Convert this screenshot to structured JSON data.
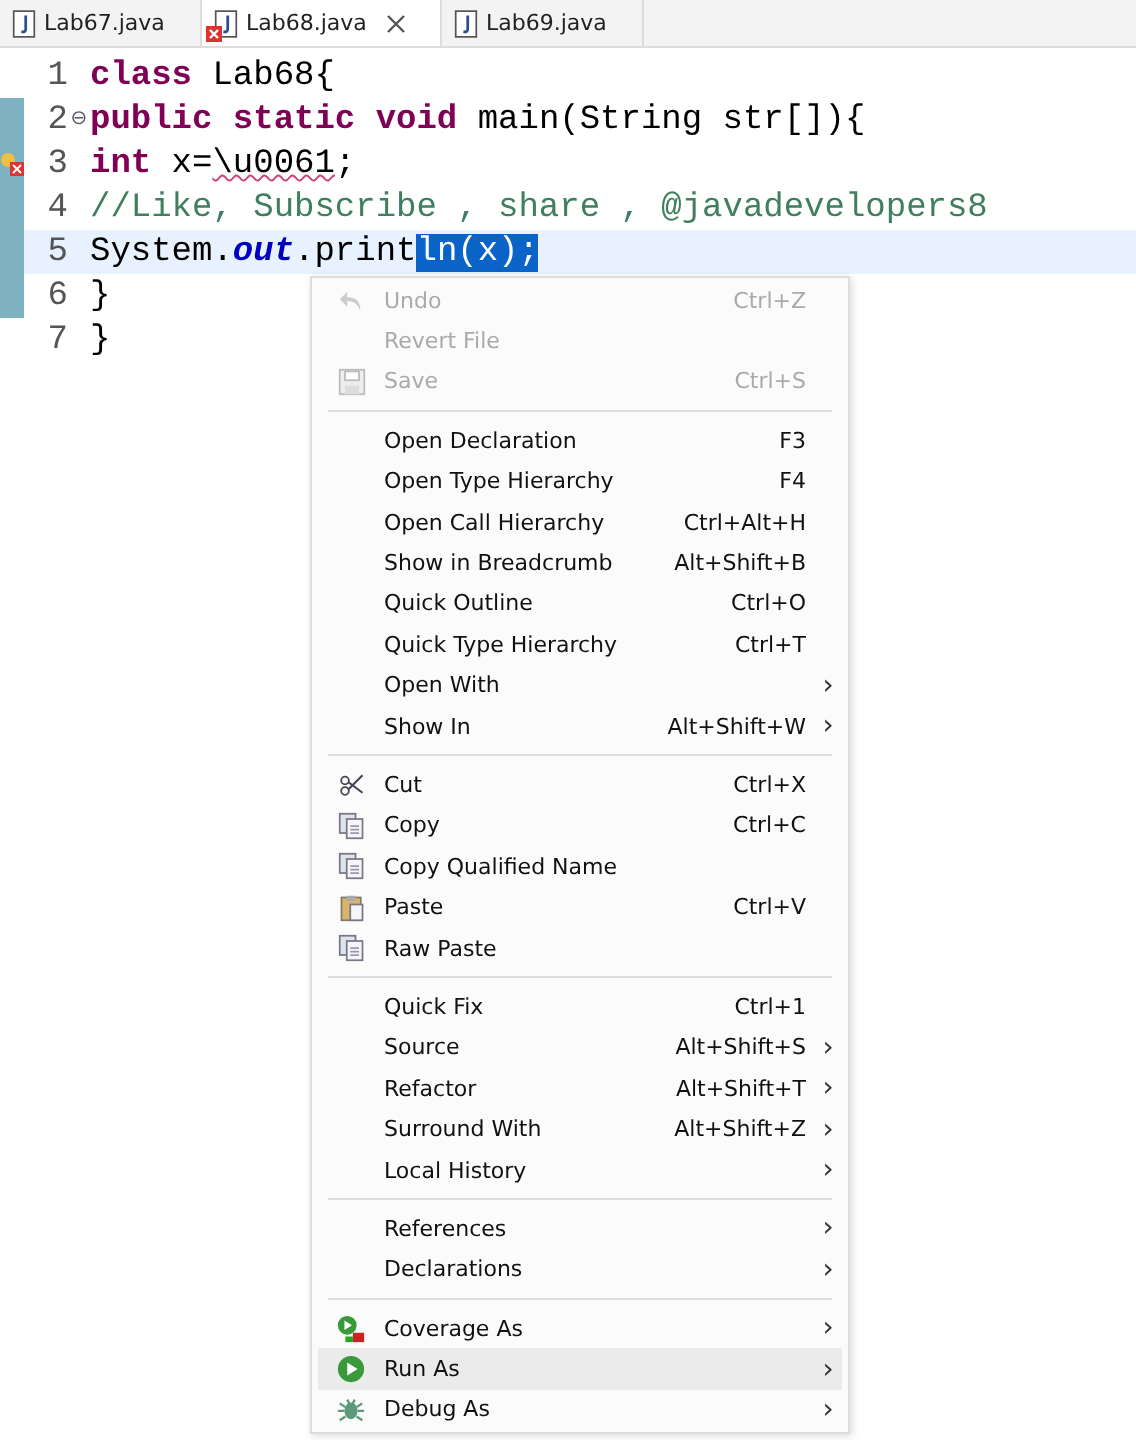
{
  "tabs": [
    {
      "label": "Lab67.java",
      "selected": false,
      "error": false
    },
    {
      "label": "Lab68.java",
      "selected": true,
      "error": true
    },
    {
      "label": "Lab69.java",
      "selected": false,
      "error": false
    }
  ],
  "editor": {
    "lines": [
      {
        "number": "1",
        "changed": false,
        "error": false,
        "current": false,
        "tokens": [
          {
            "kind": "keyword",
            "text": "class"
          },
          {
            "kind": "plain",
            "text": " Lab68{"
          }
        ]
      },
      {
        "number": "2",
        "fold_marker": "⊖",
        "changed": true,
        "error": false,
        "current": false,
        "tokens": [
          {
            "kind": "keyword",
            "text": "public static void"
          },
          {
            "kind": "plain",
            "text": " main(String str[]){"
          }
        ]
      },
      {
        "number": "3",
        "changed": true,
        "error": true,
        "current": false,
        "tokens": [
          {
            "kind": "keyword",
            "text": "int"
          },
          {
            "kind": "plain",
            "text": " x="
          },
          {
            "kind": "squiggly",
            "text": "\\u0061"
          },
          {
            "kind": "plain",
            "text": ";"
          }
        ]
      },
      {
        "number": "4",
        "changed": true,
        "error": false,
        "current": false,
        "tokens": [
          {
            "kind": "comment",
            "text": "//Like, Subscribe , share , @javadevelopers8"
          }
        ]
      },
      {
        "number": "5",
        "changed": true,
        "error": false,
        "current": true,
        "tokens": [
          {
            "kind": "plain",
            "text": "System."
          },
          {
            "kind": "field",
            "text": "out"
          },
          {
            "kind": "plain",
            "text": ".print"
          },
          {
            "kind": "selected",
            "text": "ln(x);"
          }
        ]
      },
      {
        "number": "6",
        "changed": true,
        "error": false,
        "current": false,
        "tokens": [
          {
            "kind": "plain",
            "text": "}"
          }
        ]
      },
      {
        "number": "7",
        "changed": false,
        "error": false,
        "current": false,
        "tokens": [
          {
            "kind": "plain",
            "text": "}"
          }
        ]
      }
    ]
  },
  "context_menu": {
    "groups": [
      [
        {
          "label": "Undo",
          "shortcut": "Ctrl+Z",
          "kind": "undo",
          "disabled": true,
          "selected": false
        },
        {
          "label": "Revert File",
          "kind": "plain",
          "disabled": true,
          "selected": false
        },
        {
          "label": "Save",
          "shortcut": "Ctrl+S",
          "kind": "save",
          "disabled": true,
          "selected": false
        }
      ],
      [
        {
          "label": "Open Declaration",
          "shortcut": "F3",
          "kind": "plain",
          "disabled": false,
          "selected": false
        },
        {
          "label": "Open Type Hierarchy",
          "shortcut": "F4",
          "kind": "plain",
          "disabled": false,
          "selected": false
        },
        {
          "label": "Open Call Hierarchy",
          "shortcut": "Ctrl+Alt+H",
          "kind": "plain",
          "disabled": false,
          "selected": false
        },
        {
          "label": "Show in Breadcrumb",
          "shortcut": "Alt+Shift+B",
          "kind": "plain",
          "disabled": false,
          "selected": false
        },
        {
          "label": "Quick Outline",
          "shortcut": "Ctrl+O",
          "kind": "plain",
          "disabled": false,
          "selected": false
        },
        {
          "label": "Quick Type Hierarchy",
          "shortcut": "Ctrl+T",
          "kind": "plain",
          "disabled": false,
          "selected": false
        },
        {
          "label": "Open With",
          "kind": "plain",
          "disabled": false,
          "selected": false,
          "arrow": "›"
        },
        {
          "label": "Show In",
          "shortcut": "Alt+Shift+W",
          "kind": "plain",
          "disabled": false,
          "selected": false,
          "arrow": "›"
        }
      ],
      [
        {
          "label": "Cut",
          "shortcut": "Ctrl+X",
          "kind": "cut",
          "disabled": false,
          "selected": false
        },
        {
          "label": "Copy",
          "shortcut": "Ctrl+C",
          "kind": "copy",
          "disabled": false,
          "selected": false
        },
        {
          "label": "Copy Qualified Name",
          "kind": "copy",
          "disabled": false,
          "selected": false
        },
        {
          "label": "Paste",
          "shortcut": "Ctrl+V",
          "kind": "paste",
          "disabled": false,
          "selected": false
        },
        {
          "label": "Raw Paste",
          "kind": "copy",
          "disabled": false,
          "selected": false
        }
      ],
      [
        {
          "label": "Quick Fix",
          "shortcut": "Ctrl+1",
          "kind": "plain",
          "disabled": false,
          "selected": false
        },
        {
          "label": "Source",
          "shortcut": "Alt+Shift+S",
          "kind": "plain",
          "disabled": false,
          "selected": false,
          "arrow": "›"
        },
        {
          "label": "Refactor",
          "shortcut": "Alt+Shift+T",
          "kind": "plain",
          "disabled": false,
          "selected": false,
          "arrow": "›"
        },
        {
          "label": "Surround With",
          "shortcut": "Alt+Shift+Z",
          "kind": "plain",
          "disabled": false,
          "selected": false,
          "arrow": "›"
        },
        {
          "label": "Local History",
          "kind": "plain",
          "disabled": false,
          "selected": false,
          "arrow": "›"
        }
      ],
      [
        {
          "label": "References",
          "kind": "plain",
          "disabled": false,
          "selected": false,
          "arrow": "›"
        },
        {
          "label": "Declarations",
          "kind": "plain",
          "disabled": false,
          "selected": false,
          "arrow": "›"
        }
      ],
      [
        {
          "label": "Coverage As",
          "kind": "coverage",
          "disabled": false,
          "selected": false,
          "arrow": "›"
        },
        {
          "label": "Run As",
          "kind": "run",
          "disabled": false,
          "selected": true,
          "arrow": "›"
        },
        {
          "label": "Debug As",
          "kind": "debug",
          "disabled": false,
          "selected": false,
          "arrow": "›"
        }
      ]
    ]
  }
}
